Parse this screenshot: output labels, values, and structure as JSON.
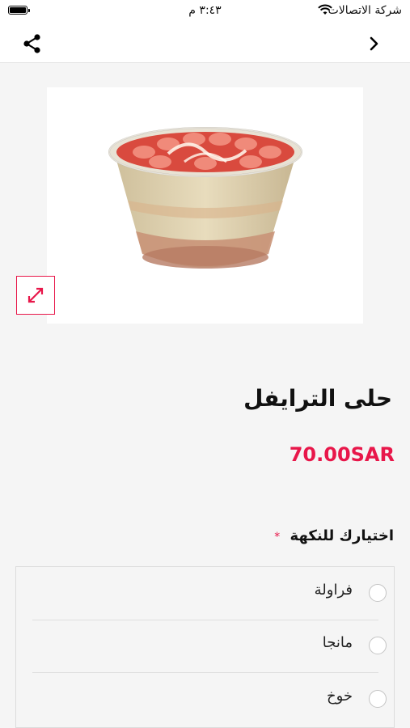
{
  "status_bar": {
    "carrier": "شركة الاتصالات",
    "time": "٣:٤٣ م"
  },
  "nav": {
    "back_icon": "chevron-right-icon",
    "share_icon": "share-icon"
  },
  "product": {
    "title": "حلى الترايفل",
    "price": "70.00SAR",
    "image_alt": "trifle-dessert-cup",
    "expand_icon": "expand-arrows-icon"
  },
  "flavor": {
    "label": "اختيارك للنكهة",
    "required_mark": "*",
    "options": [
      {
        "label": "فراولة",
        "selected": false
      },
      {
        "label": "مانجا",
        "selected": false
      },
      {
        "label": "خوخ",
        "selected": false
      }
    ]
  },
  "colors": {
    "accent": "#e8174a",
    "background": "#f5f5f5"
  }
}
